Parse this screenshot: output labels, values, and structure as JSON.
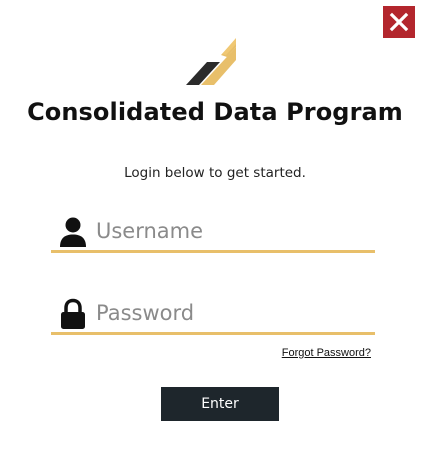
{
  "window": {
    "close_icon": "close-icon",
    "close_color": "#b3262d"
  },
  "header": {
    "logo_icon": "logo-icon",
    "title": "Consolidated Data Program",
    "subtitle": "Login below to get started."
  },
  "form": {
    "username": {
      "icon": "user-icon",
      "value": "",
      "placeholder": "Username"
    },
    "password": {
      "icon": "lock-icon",
      "value": "",
      "placeholder": "Password"
    },
    "forgot_password_label": "Forgot Password?",
    "enter_label": "Enter"
  },
  "colors": {
    "accent": "#e8bf6a",
    "button_bg": "#1e262c",
    "close_bg": "#b3262d"
  }
}
